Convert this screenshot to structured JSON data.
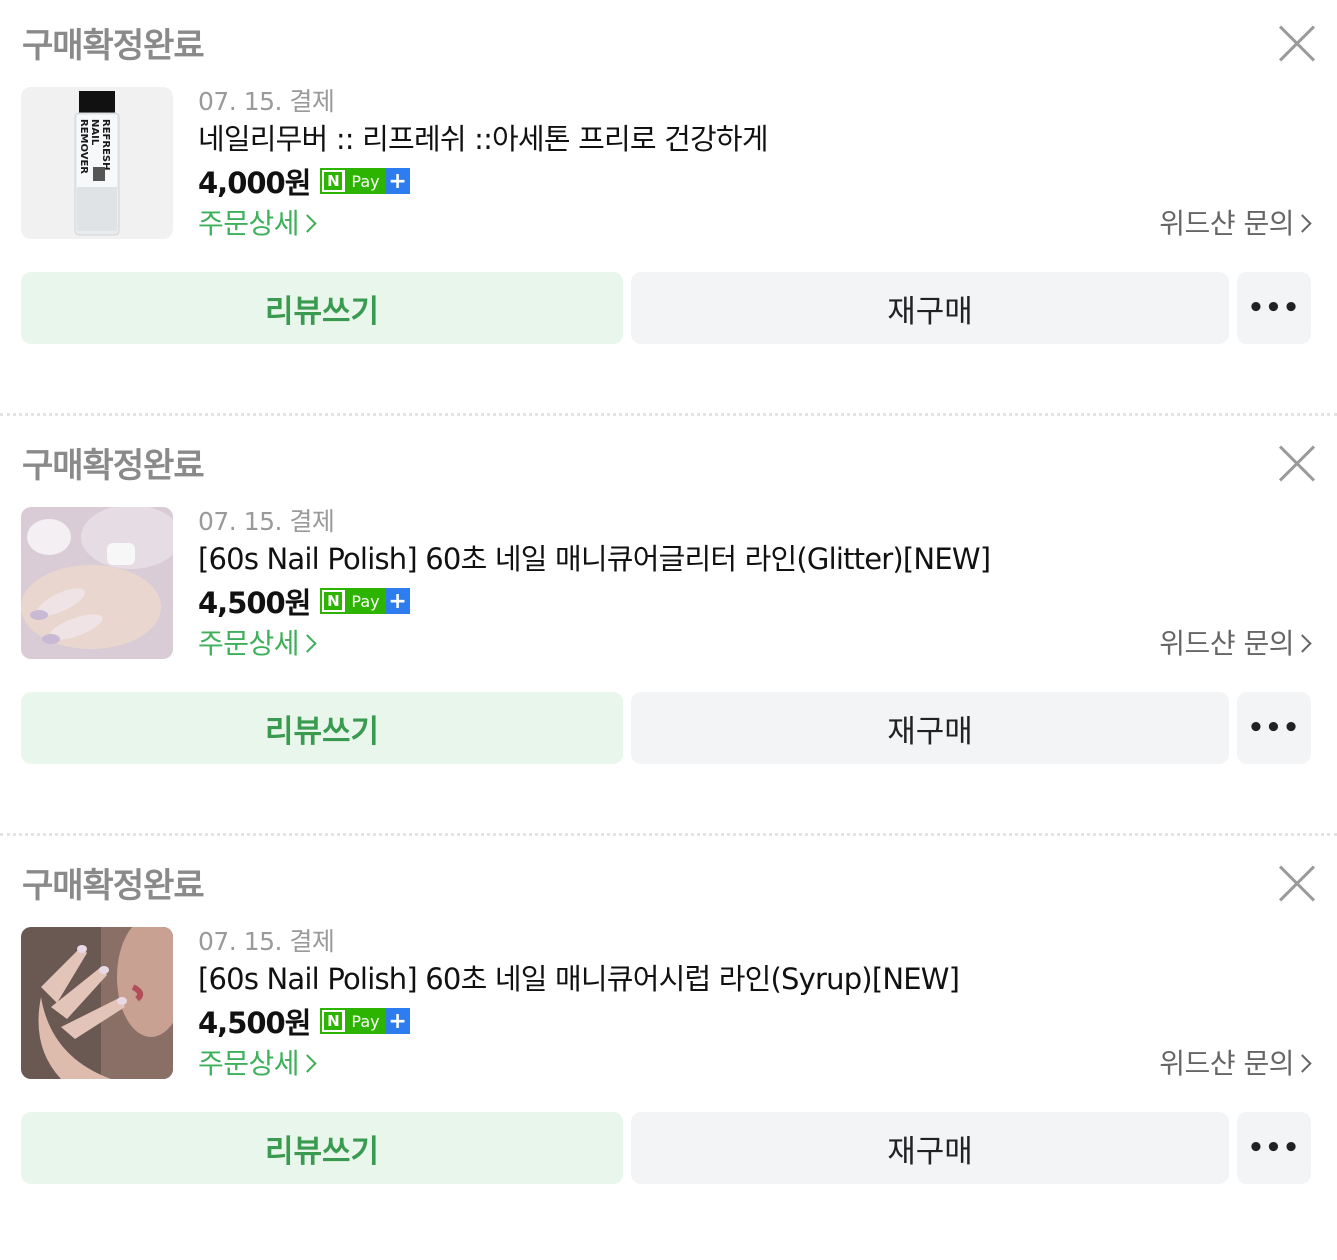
{
  "orders": [
    {
      "status": "구매확정완료",
      "date": "07. 15. 결제",
      "title": "네일리무버 :: 리프레쉬 ::아세톤 프리로 건강하게",
      "price": "4,000원",
      "detail_link": "주문상세",
      "inquiry_link": "위드샨 문의",
      "review_btn": "리뷰쓰기",
      "rebuy_btn": "재구매",
      "more_btn": "•••",
      "thumb_text": {
        "line1": "REFRESH",
        "line2": "NAIL",
        "line3": "REMOVER"
      }
    },
    {
      "status": "구매확정완료",
      "date": "07. 15. 결제",
      "title": "[60s Nail Polish] 60초 네일 매니큐어글리터 라인(Glitter)[NEW]",
      "price": "4,500원",
      "detail_link": "주문상세",
      "inquiry_link": "위드샨 문의",
      "review_btn": "리뷰쓰기",
      "rebuy_btn": "재구매",
      "more_btn": "•••"
    },
    {
      "status": "구매확정완료",
      "date": "07. 15. 결제",
      "title": "[60s Nail Polish] 60초 네일 매니큐어시럽 라인(Syrup)[NEW]",
      "price": "4,500원",
      "detail_link": "주문상세",
      "inquiry_link": "위드샨 문의",
      "review_btn": "리뷰쓰기",
      "rebuy_btn": "재구매",
      "more_btn": "•••"
    }
  ],
  "npay_badge": {
    "n": "N",
    "pay": "Pay",
    "plus": "+"
  },
  "colors": {
    "status_gray": "#8a8a8a",
    "link_green": "#3fb05a",
    "review_bg": "#e9f6ec",
    "button_gray_bg": "#f3f4f6",
    "npay_green": "#2db400",
    "npay_blue": "#2d7df0"
  }
}
